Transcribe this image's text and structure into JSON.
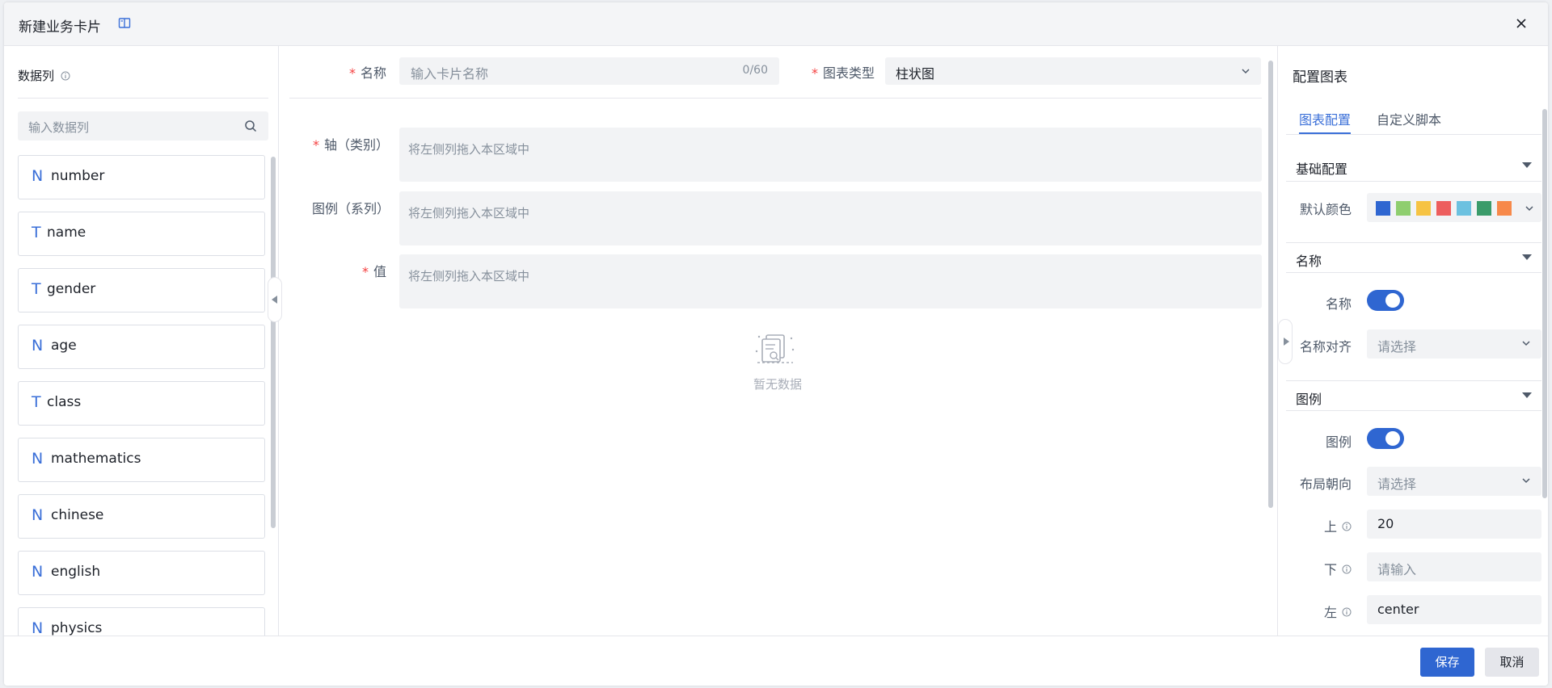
{
  "header": {
    "title": "新建业务卡片",
    "close_icon": "close-icon",
    "doc_icon": "book-icon"
  },
  "left": {
    "title": "数据列",
    "search_placeholder": "输入数据列",
    "columns": [
      {
        "type": "N",
        "name": "number"
      },
      {
        "type": "T",
        "name": "name"
      },
      {
        "type": "T",
        "name": "gender"
      },
      {
        "type": "N",
        "name": "age"
      },
      {
        "type": "T",
        "name": "class"
      },
      {
        "type": "N",
        "name": "mathematics"
      },
      {
        "type": "N",
        "name": "chinese"
      },
      {
        "type": "N",
        "name": "english"
      },
      {
        "type": "N",
        "name": "physics"
      }
    ]
  },
  "center": {
    "name_label": "名称",
    "name_placeholder": "输入卡片名称",
    "name_count": "0/60",
    "chart_type_label": "图表类型",
    "chart_type_value": "柱状图",
    "axis_label": "轴（类别）",
    "legend_label": "图例（系列）",
    "value_label": "值",
    "drop_placeholder": "将左侧列拖入本区域中",
    "empty_text": "暂无数据"
  },
  "right": {
    "title": "配置图表",
    "tabs": [
      "图表配置",
      "自定义脚本"
    ],
    "basic_section": "基础配置",
    "default_color_label": "默认颜色",
    "colors": [
      "#2f66d1",
      "#8fce6f",
      "#f6c343",
      "#ed5e5e",
      "#6cc1e0",
      "#3a9b6a",
      "#f7894a"
    ],
    "name_section": "名称",
    "name_toggle_label": "名称",
    "name_align_label": "名称对齐",
    "select_placeholder": "请选择",
    "legend_section": "图例",
    "legend_toggle_label": "图例",
    "layout_label": "布局朝向",
    "top_label": "上",
    "top_value": "20",
    "bottom_label": "下",
    "bottom_placeholder": "请输入",
    "left_label": "左",
    "left_value": "center"
  },
  "footer": {
    "save": "保存",
    "cancel": "取消"
  }
}
